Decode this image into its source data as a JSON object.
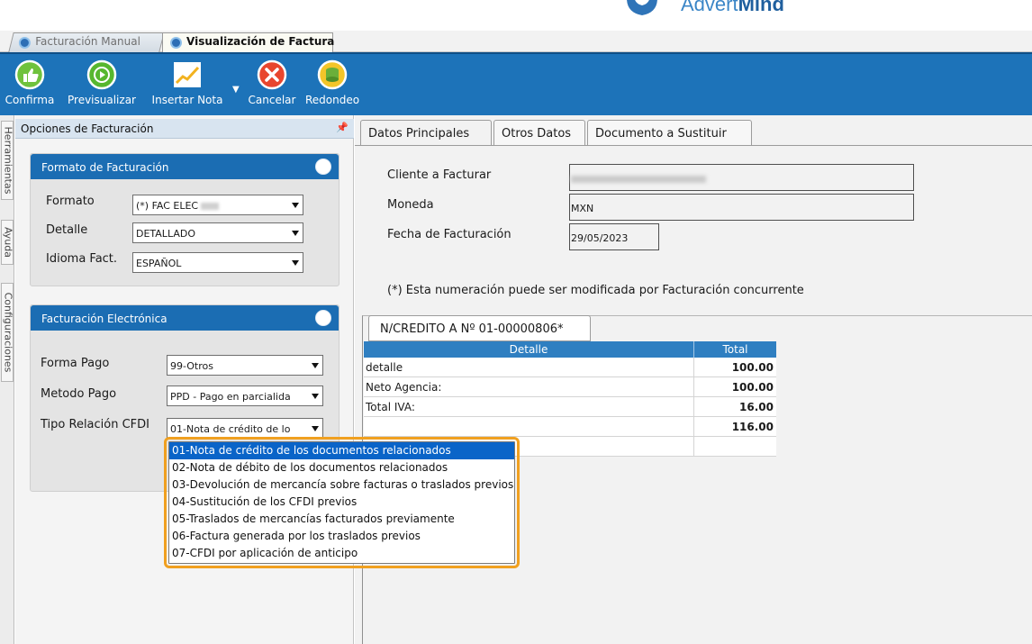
{
  "brand": {
    "logo_text_light": "Advert",
    "logo_text_bold": "Mind"
  },
  "doc_tabs": [
    {
      "label": "Facturación Manual"
    },
    {
      "label": "Visualización de Factura"
    }
  ],
  "toolbar": {
    "buttons": [
      {
        "label": "Confirma",
        "icon": "thumbs-up-icon"
      },
      {
        "label": "Previsualizar",
        "icon": "play-icon"
      },
      {
        "label": "Insertar Nota",
        "icon": "trend-chart-icon"
      },
      {
        "label": "Cancelar",
        "icon": "cancel-icon"
      },
      {
        "label": "Redondeo",
        "icon": "coins-icon"
      }
    ]
  },
  "side_tabs": [
    "Herramientas",
    "Ayuda",
    "Configuraciones"
  ],
  "left_panel": {
    "title": "Opciones de Facturación",
    "formato_group": {
      "title": "Formato de Facturación",
      "fields": [
        {
          "label": "Formato",
          "value": "(*) FAC ELEC"
        },
        {
          "label": "Detalle",
          "value": "DETALLADO"
        },
        {
          "label": "Idioma Fact.",
          "value": "ESPAÑOL"
        }
      ]
    },
    "fe_group": {
      "title": "Facturación Electrónica",
      "fields": [
        {
          "label": "Forma Pago",
          "value": "99-Otros"
        },
        {
          "label": "Metodo Pago",
          "value": "PPD - Pago en parcialida"
        },
        {
          "label": "Tipo Relación CFDI",
          "value": "01-Nota de crédito de lo"
        }
      ]
    },
    "dropdown_options": [
      "01-Nota de crédito de los documentos relacionados",
      "02-Nota de débito de los documentos relacionados",
      "03-Devolución de mercancía sobre facturas o traslados previos",
      "04-Sustitución de los CFDI previos",
      "05-Traslados de mercancías facturados previamente",
      "06-Factura generada por los traslados previos",
      "07-CFDI por aplicación de anticipo"
    ]
  },
  "right_panel": {
    "tabs": [
      "Datos Principales",
      "Otros Datos",
      "Documento a Sustituir"
    ],
    "fields": {
      "cliente_label": "Cliente a Facturar",
      "moneda_label": "Moneda",
      "moneda_value": "MXN",
      "fecha_label": "Fecha de Facturación",
      "fecha_value": "29/05/2023"
    },
    "note": "(*) Esta numeración puede ser modificada por Facturación concurrente",
    "nc_tab": "N/CREDITO A Nº 01-00000806*",
    "grid": {
      "headers": [
        "Detalle",
        "Total"
      ],
      "rows": [
        {
          "detalle": "detalle",
          "total": "100.00"
        },
        {
          "detalle": "Neto Agencia:",
          "total": "100.00"
        },
        {
          "detalle": "Total IVA:",
          "total": "16.00"
        },
        {
          "detalle": "",
          "total": "116.00"
        },
        {
          "detalle": "",
          "total": ""
        }
      ]
    }
  },
  "colors": {
    "toolbar": "#1d73b9",
    "group_header": "#1b6db3",
    "grid_header": "#2f7fc1",
    "dropdown_highlight": "#f0a020",
    "selection": "#0a64c8"
  }
}
